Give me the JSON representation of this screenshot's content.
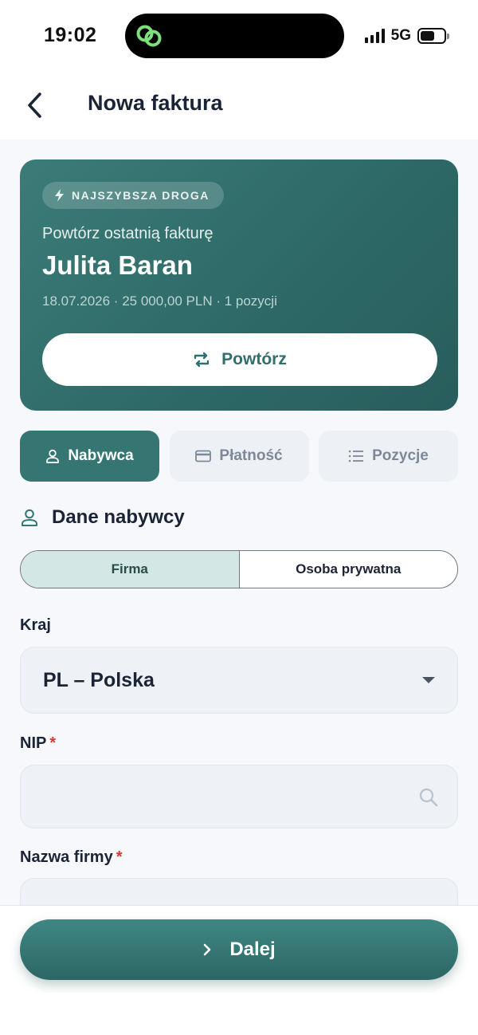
{
  "status_bar": {
    "time": "19:02",
    "network": "5G",
    "battery_level": 0.6,
    "island_icon": "link-icon"
  },
  "header": {
    "title": "Nowa faktura",
    "back_icon": "chevron-left-icon"
  },
  "hero": {
    "badge": "NAJSZYBSZA DROGA",
    "badge_icon": "lightning-icon",
    "subtitle": "Powtórz ostatnią fakturę",
    "name": "Julita Baran",
    "meta": "18.07.2026 · 25 000,00 PLN · 1 pozycji",
    "button_label": "Powtórz",
    "button_icon": "repeat-icon"
  },
  "tabs": [
    {
      "label": "Nabywca",
      "icon": "user-icon",
      "active": true
    },
    {
      "label": "Płatność",
      "icon": "credit-card-icon",
      "active": false
    },
    {
      "label": "Pozycje",
      "icon": "list-icon",
      "active": false
    }
  ],
  "section": {
    "title": "Dane nabywcy",
    "icon": "user-icon"
  },
  "buyer_type": {
    "options": [
      "Firma",
      "Osoba prywatna"
    ],
    "selected": "Firma"
  },
  "fields": {
    "country": {
      "label": "Kraj",
      "value": "PL – Polska"
    },
    "nip": {
      "label": "NIP",
      "required_mark": "*",
      "value": "",
      "icon": "search-icon"
    },
    "company_name": {
      "label": "Nazwa firmy",
      "required_mark": "*",
      "value": ""
    }
  },
  "footer": {
    "next_label": "Dalej",
    "next_icon": "chevron-right-icon"
  },
  "colors": {
    "accent": "#357572",
    "hero_start": "#3b7c78",
    "hero_end": "#285e5d",
    "required": "#d23b2e",
    "island_icon": "#7ee07a"
  }
}
